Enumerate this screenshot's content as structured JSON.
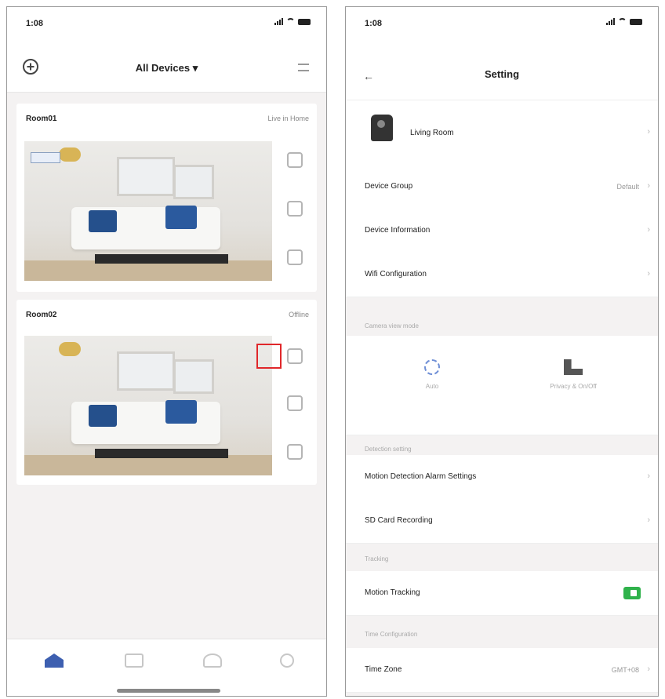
{
  "left": {
    "status": {
      "time": "1:08"
    },
    "header": {
      "title": "All Devices ▾"
    },
    "cards": [
      {
        "name": "Room01",
        "status": "Live in Home"
      },
      {
        "name": "Room02",
        "status": "Offline"
      }
    ],
    "tabs": [
      "home-icon",
      "scene-icon",
      "mall-icon",
      "me-icon"
    ]
  },
  "right": {
    "status": {
      "time": "1:08"
    },
    "header": {
      "title": "Setting"
    },
    "device": {
      "name": "Living Room"
    },
    "rows": [
      {
        "label": "Device Group",
        "value": "Default"
      },
      {
        "label": "Device Information",
        "value": ""
      },
      {
        "label": "Wifi Configuration",
        "value": ""
      }
    ],
    "section_modes": "Camera view mode",
    "modes": [
      {
        "label": "Auto"
      },
      {
        "label": "Privacy & On/Off"
      }
    ],
    "section_detect": "Detection setting",
    "detect_rows": [
      {
        "label": "Motion Detection Alarm Settings"
      },
      {
        "label": "SD Card Recording"
      }
    ],
    "section_tracking": "Tracking",
    "tracking_row": {
      "label": "Motion Tracking"
    },
    "section_time": "Time Configuration",
    "time_row": {
      "label": "Time Zone",
      "value": "GMT+08"
    }
  }
}
